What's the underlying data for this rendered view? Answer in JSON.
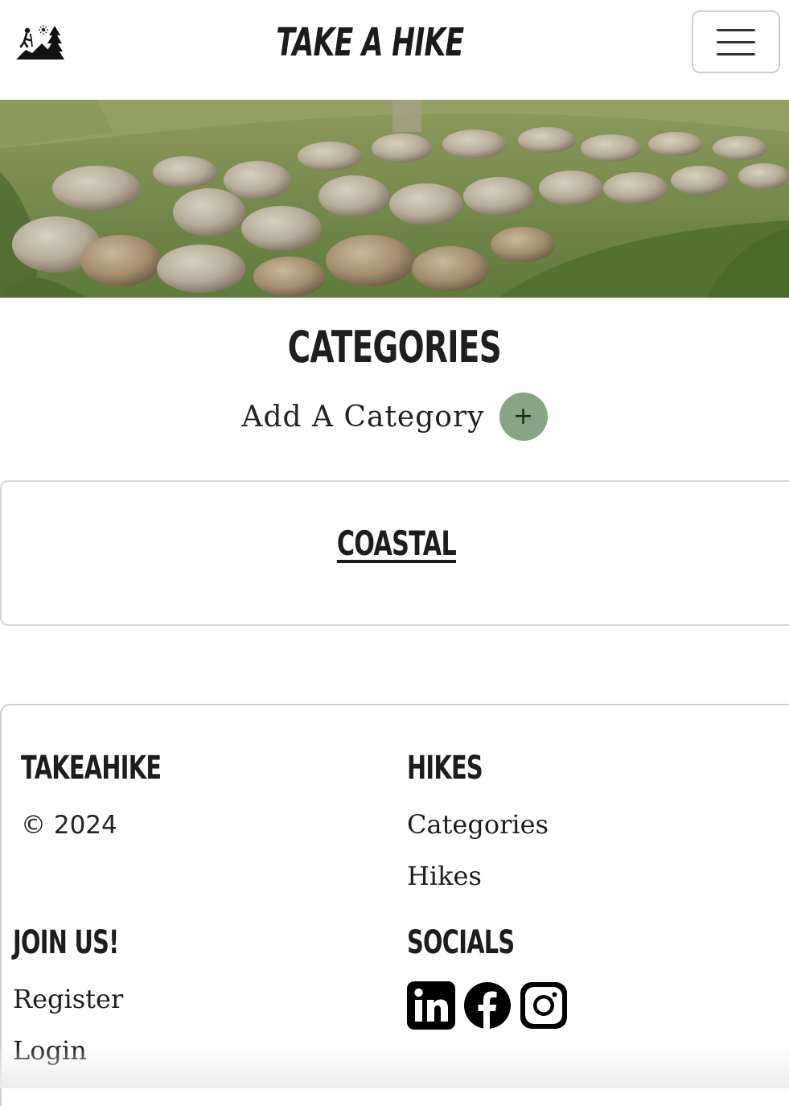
{
  "header": {
    "brand": "TAKE A HIKE",
    "logo_icon": "hiker-trees-logo-icon",
    "menu_icon": "hamburger-menu-icon"
  },
  "hero": {
    "image": "stone-wall-hillside-photo"
  },
  "main": {
    "title": "CATEGORIES",
    "add_label": "Add A Category",
    "add_icon": "plus-icon",
    "categories": [
      {
        "name": "COASTAL"
      }
    ]
  },
  "footer": {
    "brand_heading": "TAKEAHIKE",
    "copyright": "© 2024",
    "hikes_heading": "HIKES",
    "hikes_links": [
      "Categories",
      "Hikes"
    ],
    "join_heading": "JOIN US!",
    "join_links": [
      "Register",
      "Login"
    ],
    "socials_heading": "SOCIALS",
    "social_icons": [
      "linkedin-icon",
      "facebook-icon",
      "instagram-icon"
    ]
  },
  "colors": {
    "accent_green": "#87a584",
    "text_dark": "#1d1d1d",
    "border": "#d0d0d0"
  }
}
